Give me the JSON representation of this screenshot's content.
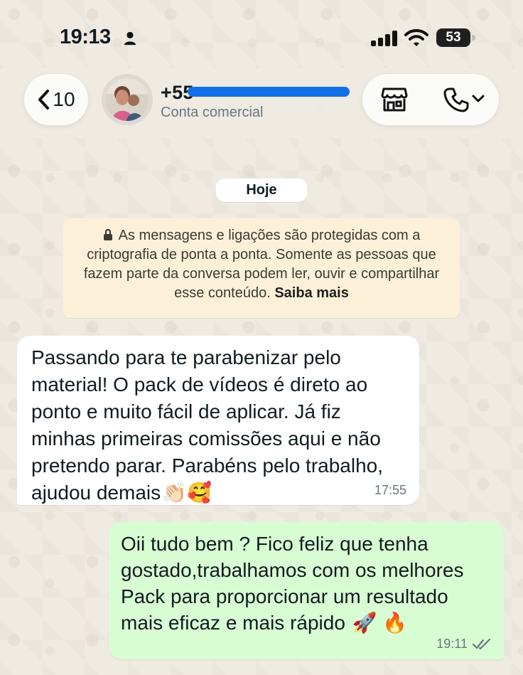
{
  "status_bar": {
    "time": "19:13",
    "battery": "53",
    "person_icon": "person-icon",
    "signal_icon": "signal-bars-icon",
    "wifi_icon": "wifi-icon"
  },
  "header": {
    "back_count": "10",
    "contact_number": "+55",
    "contact_label": "Conta comercial",
    "icons": {
      "back": "chevron-left-icon",
      "store": "store-icon",
      "call": "phone-icon",
      "call_menu": "chevron-down-icon"
    }
  },
  "chat": {
    "day_label": "Hoje",
    "encryption_notice": {
      "text": "As mensagens e ligações são protegidas com a criptografia de ponta a ponta. Somente as pessoas que fazem parte da conversa podem ler, ouvir e compartilhar esse conteúdo.",
      "link": "Saiba mais"
    },
    "messages": [
      {
        "direction": "incoming",
        "text": "Passando para te parabenizar pelo\nmaterial! O pack de vídeos é direto ao\nponto e muito fácil de aplicar. Já fiz\nminhas primeiras comissões aqui e não\npretendo parar. Parabéns pelo trabalho,\najudou demais",
        "emoji": "👏🏻🥰",
        "time": "17:55"
      },
      {
        "direction": "outgoing",
        "text": "Oii tudo bem ? Fico feliz que tenha\ngostado,trabalhamos com os melhores\nPack para proporcionar um resultado\nmais eficaz e mais rápido",
        "emoji": "🚀 🔥",
        "time": "19:11"
      }
    ]
  },
  "colors": {
    "wallpaper": "#efeae2",
    "incoming_bubble": "#ffffff",
    "outgoing_bubble": "#d9fdd3",
    "system_notice": "#fcf1d8",
    "meta_text": "#667781",
    "redaction": "#1170e8"
  }
}
